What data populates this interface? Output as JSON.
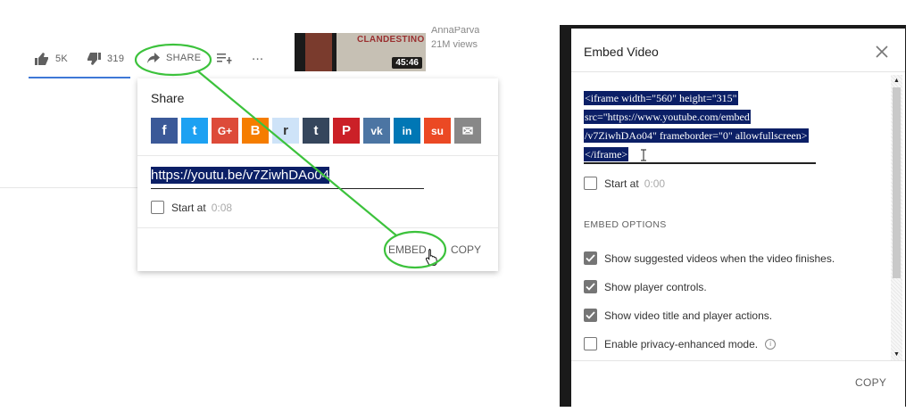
{
  "action_bar": {
    "like_count": "5K",
    "dislike_count": "319",
    "share_label": "SHARE",
    "more_label": "..."
  },
  "suggested": {
    "thumb_title": "CLANDESTINO",
    "duration": "45:46",
    "channel": "AnnaParva",
    "views": "21M views"
  },
  "share_panel": {
    "title": "Share",
    "socials": [
      {
        "name": "facebook-icon",
        "glyph": "f",
        "color": "#3b5998"
      },
      {
        "name": "twitter-icon",
        "glyph": "t",
        "color": "#1da1f2"
      },
      {
        "name": "google-plus-icon",
        "glyph": "G+",
        "color": "#dd4b39"
      },
      {
        "name": "blogger-icon",
        "glyph": "B",
        "color": "#f57d00"
      },
      {
        "name": "reddit-icon",
        "glyph": "r",
        "color": "#cee3f8"
      },
      {
        "name": "tumblr-icon",
        "glyph": "t",
        "color": "#35465c"
      },
      {
        "name": "pinterest-icon",
        "glyph": "P",
        "color": "#cb2027"
      },
      {
        "name": "vk-icon",
        "glyph": "vk",
        "color": "#4c75a3"
      },
      {
        "name": "linkedin-icon",
        "glyph": "in",
        "color": "#0077b5"
      },
      {
        "name": "stumbleupon-icon",
        "glyph": "su",
        "color": "#eb4924"
      },
      {
        "name": "email-icon",
        "glyph": "✉",
        "color": "#888888"
      }
    ],
    "link": "https://youtu.be/v7ZiwhDAo04",
    "start_at_label": "Start at",
    "start_at_time": "0:08",
    "embed_label": "EMBED",
    "copy_label": "COPY"
  },
  "embed_dialog": {
    "title": "Embed Video",
    "code_lines": [
      "<iframe width=\"560\" height=\"315\"",
      "src=\"https://www.youtube.com/embed",
      "/v7ZiwhDAo04\" frameborder=\"0\" allowfullscreen>",
      "</iframe>"
    ],
    "start_at_label": "Start at",
    "start_at_time": "0:00",
    "options_heading": "EMBED OPTIONS",
    "options": [
      {
        "label": "Show suggested videos when the video finishes.",
        "checked": true
      },
      {
        "label": "Show player controls.",
        "checked": true
      },
      {
        "label": "Show video title and player actions.",
        "checked": true
      },
      {
        "label": "Enable privacy-enhanced mode.",
        "checked": false
      }
    ],
    "copy_label": "COPY"
  },
  "colors": {
    "selection": "#0b1f66",
    "annotation": "#3cc23c",
    "like_underline": "#3e78d6"
  }
}
